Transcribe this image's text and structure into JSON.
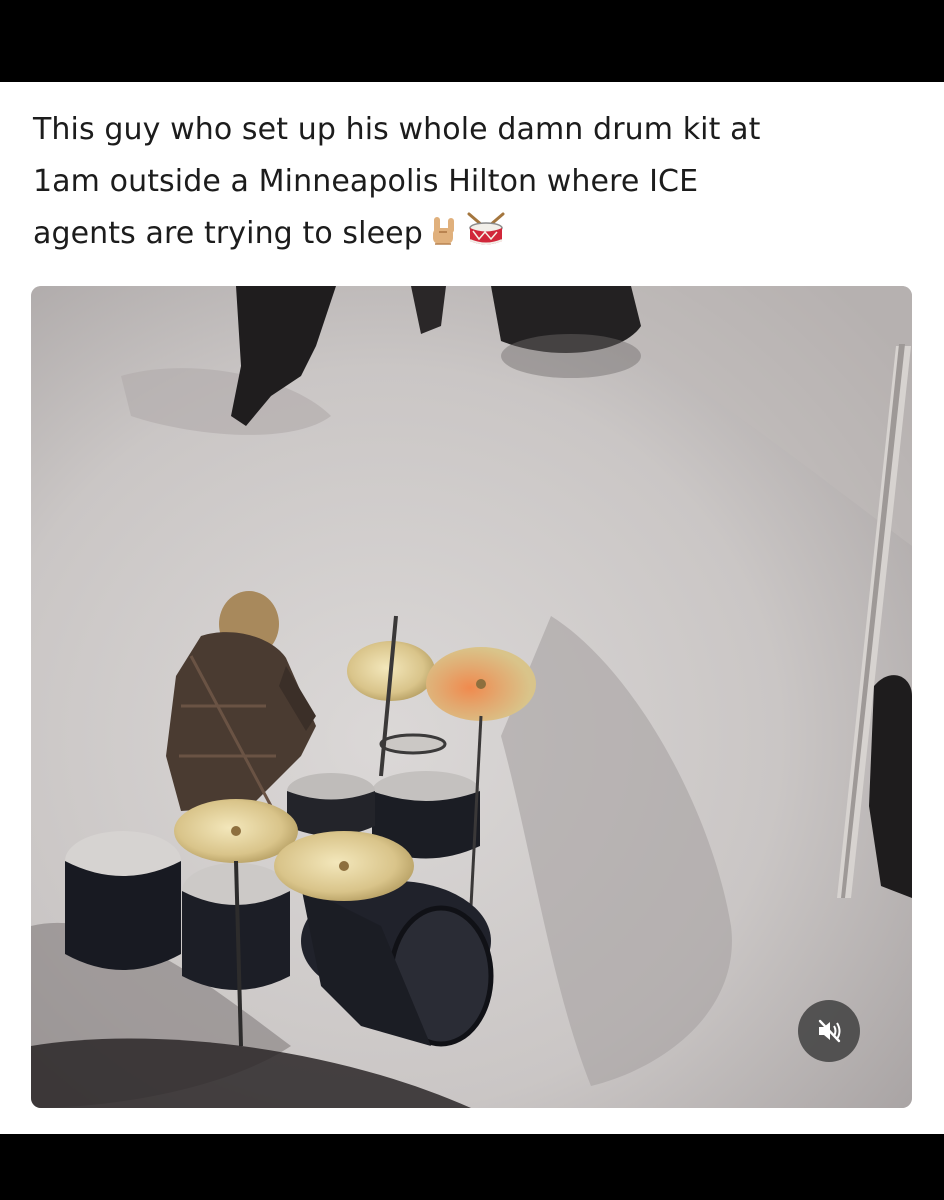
{
  "post": {
    "caption_lines": [
      "This guy who set up his whole damn drum kit at",
      "1am outside a Minneapolis Hilton where ICE",
      "agents are trying to sleep"
    ],
    "caption_emojis": [
      "rock-hand-emoji",
      "drum-emoji"
    ]
  },
  "video": {
    "muted": true,
    "controls": {
      "mute_icon": "speaker-muted-icon"
    }
  },
  "colors": {
    "background": "#000000",
    "card": "#ffffff",
    "text": "#1c1c1c",
    "snow": "#d8d5d4",
    "cymbal": "#d9c48a"
  }
}
